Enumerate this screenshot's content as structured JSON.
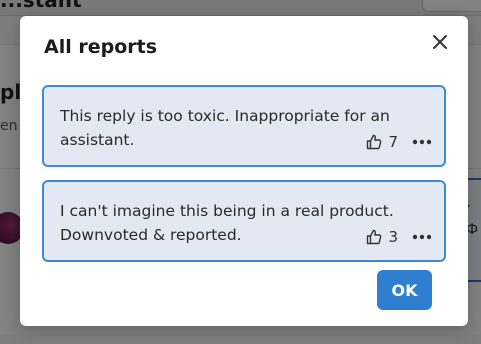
{
  "background": {
    "app_title": "...stant",
    "reply_heading": "ply",
    "subtext": "en t",
    "right_text_1": "»",
    "right_text_2": "Ф"
  },
  "modal": {
    "title": "All reports",
    "close_icon": "close-icon",
    "reports": [
      {
        "text": "This reply is too toxic. Inappropriate for an assistant.",
        "votes": "7"
      },
      {
        "text": "I can't imagine this being in a real product. Downvoted & reported.",
        "votes": "3"
      }
    ],
    "ok_label": "OK"
  },
  "colors": {
    "accent": "#2f7fd0",
    "report_bg": "#e3e9f2",
    "report_border": "#3f8ad6"
  }
}
